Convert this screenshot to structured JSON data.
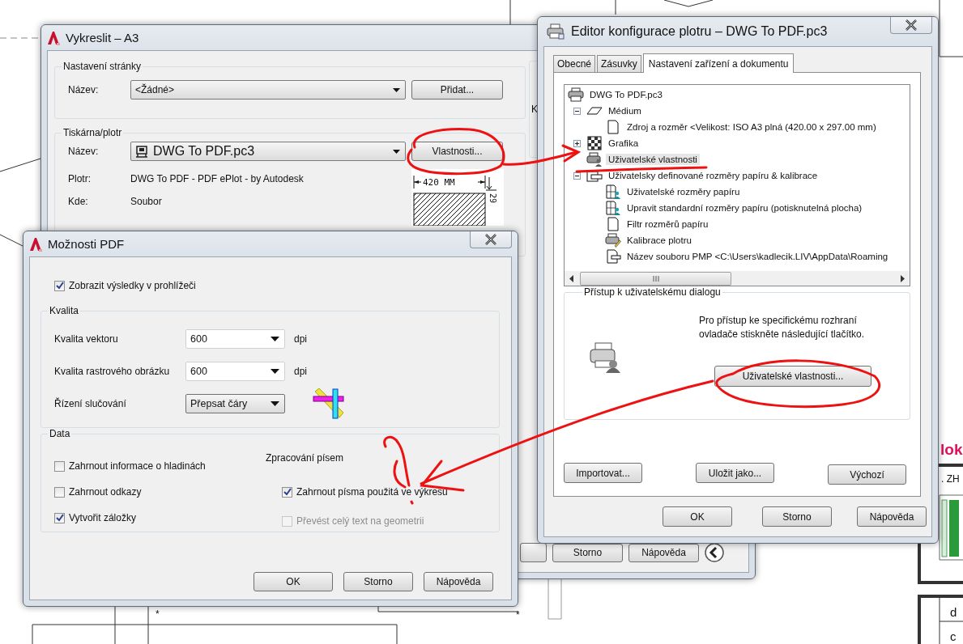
{
  "drawing": {
    "marks": [
      "*",
      "*"
    ],
    "title_fragment": "lok",
    "label_fragment": ". ZH",
    "table_cells": [
      "d",
      "c"
    ]
  },
  "plot_dialog": {
    "title": "Vykreslit – A3",
    "page_setup": {
      "legend": "Nastavení stránky",
      "name_label": "Název:",
      "name_value": "<Žádné>",
      "add_button": "Přidat..."
    },
    "printer": {
      "legend": "Tiskárna/plotr",
      "name_label": "Název:",
      "name_value": "DWG To PDF.pc3",
      "properties_button": "Vlastnosti...",
      "plotter_label": "Plotr:",
      "plotter_value": "DWG To PDF - PDF ePlot - by Autodesk",
      "where_label": "Kde:",
      "where_value": "Soubor",
      "preview": {
        "width_label": "420 MM",
        "height_label": "29"
      }
    },
    "side_fragment": "K",
    "buttons": [
      "Storno",
      "Nápověda"
    ]
  },
  "pdf_dialog": {
    "title": "Možnosti PDF",
    "show_results": {
      "label": "Zobrazit výsledky v prohlížeči",
      "checked": true
    },
    "quality": {
      "legend": "Kvalita",
      "rows": [
        {
          "label": "Kvalita vektoru",
          "value": "600",
          "unit": "dpi",
          "kind": "editable"
        },
        {
          "label": "Kvalita rastrového obrázku",
          "value": "600",
          "unit": "dpi",
          "kind": "editable"
        },
        {
          "label": "Řízení slučování",
          "value": "Přepsat čáry",
          "kind": "list"
        }
      ]
    },
    "data": {
      "legend": "Data",
      "options": [
        {
          "label": "Zahrnout informace o hladinách",
          "checked": false,
          "disabled": false
        },
        {
          "label": "Zahrnout odkazy",
          "checked": false,
          "disabled": false
        },
        {
          "label": "Vytvořit záložky",
          "checked": true,
          "disabled": false
        }
      ],
      "fonts": {
        "heading": "Zpracování písem",
        "options": [
          {
            "label": "Zahrnout písma použitá ve výkresu",
            "checked": true,
            "disabled": false
          },
          {
            "label": "Převést celý text na geometrii",
            "checked": false,
            "disabled": true
          }
        ]
      }
    },
    "buttons": [
      "OK",
      "Storno",
      "Nápověda"
    ]
  },
  "config_editor": {
    "title": "Editor konfigurace plotru – DWG To PDF.pc3",
    "tabs": [
      {
        "label": "Obecné",
        "selected": false
      },
      {
        "label": "Zásuvky",
        "selected": false
      },
      {
        "label": "Nastavení zařízení a dokumentu",
        "selected": true
      }
    ],
    "tree": [
      {
        "label": "DWG To PDF.pc3",
        "kind": "printer",
        "selected": false,
        "children": [
          {
            "label": "Médium",
            "kind": "medium",
            "expanded": true,
            "selected": false,
            "children": [
              {
                "label": "Zdroj a rozměr <Velikost: ISO A3 plná (420.00 x 297.00 mm)",
                "kind": "page",
                "selected": false
              }
            ]
          },
          {
            "label": "Grafika",
            "kind": "graphics",
            "expanded": false,
            "selected": false
          },
          {
            "label": "Uživatelské vlastnosti",
            "kind": "user-printer",
            "selected": true
          },
          {
            "label": "Uživatelsky definované rozměry papíru & kalibrace",
            "kind": "paper-sizes",
            "expanded": true,
            "selected": false,
            "children": [
              {
                "label": "Uživatelské rozměry papíru",
                "kind": "user-page",
                "selected": false
              },
              {
                "label": "Upravit standardní rozměry papíru (potisknutelná plocha)",
                "kind": "user-page",
                "selected": false
              },
              {
                "label": "Filtr rozměrů papíru",
                "kind": "page",
                "selected": false
              },
              {
                "label": "Kalibrace plotru",
                "kind": "calibration",
                "selected": false
              },
              {
                "label": "Název souboru PMP <C:\\Users\\kadlecik.LIV\\AppData\\Roaming",
                "kind": "file",
                "selected": false
              }
            ]
          }
        ]
      }
    ],
    "access_group": {
      "legend": "Přístup k uživatelskému dialogu",
      "description": "Pro přístup ke specifickému rozhraní ovladače stiskněte následující tlačítko.",
      "button": "Uživatelské vlastnosti..."
    },
    "panel_buttons": [
      "Importovat...",
      "Uložit jako...",
      "Výchozí"
    ],
    "buttons": [
      "OK",
      "Storno",
      "Nápověda"
    ]
  }
}
